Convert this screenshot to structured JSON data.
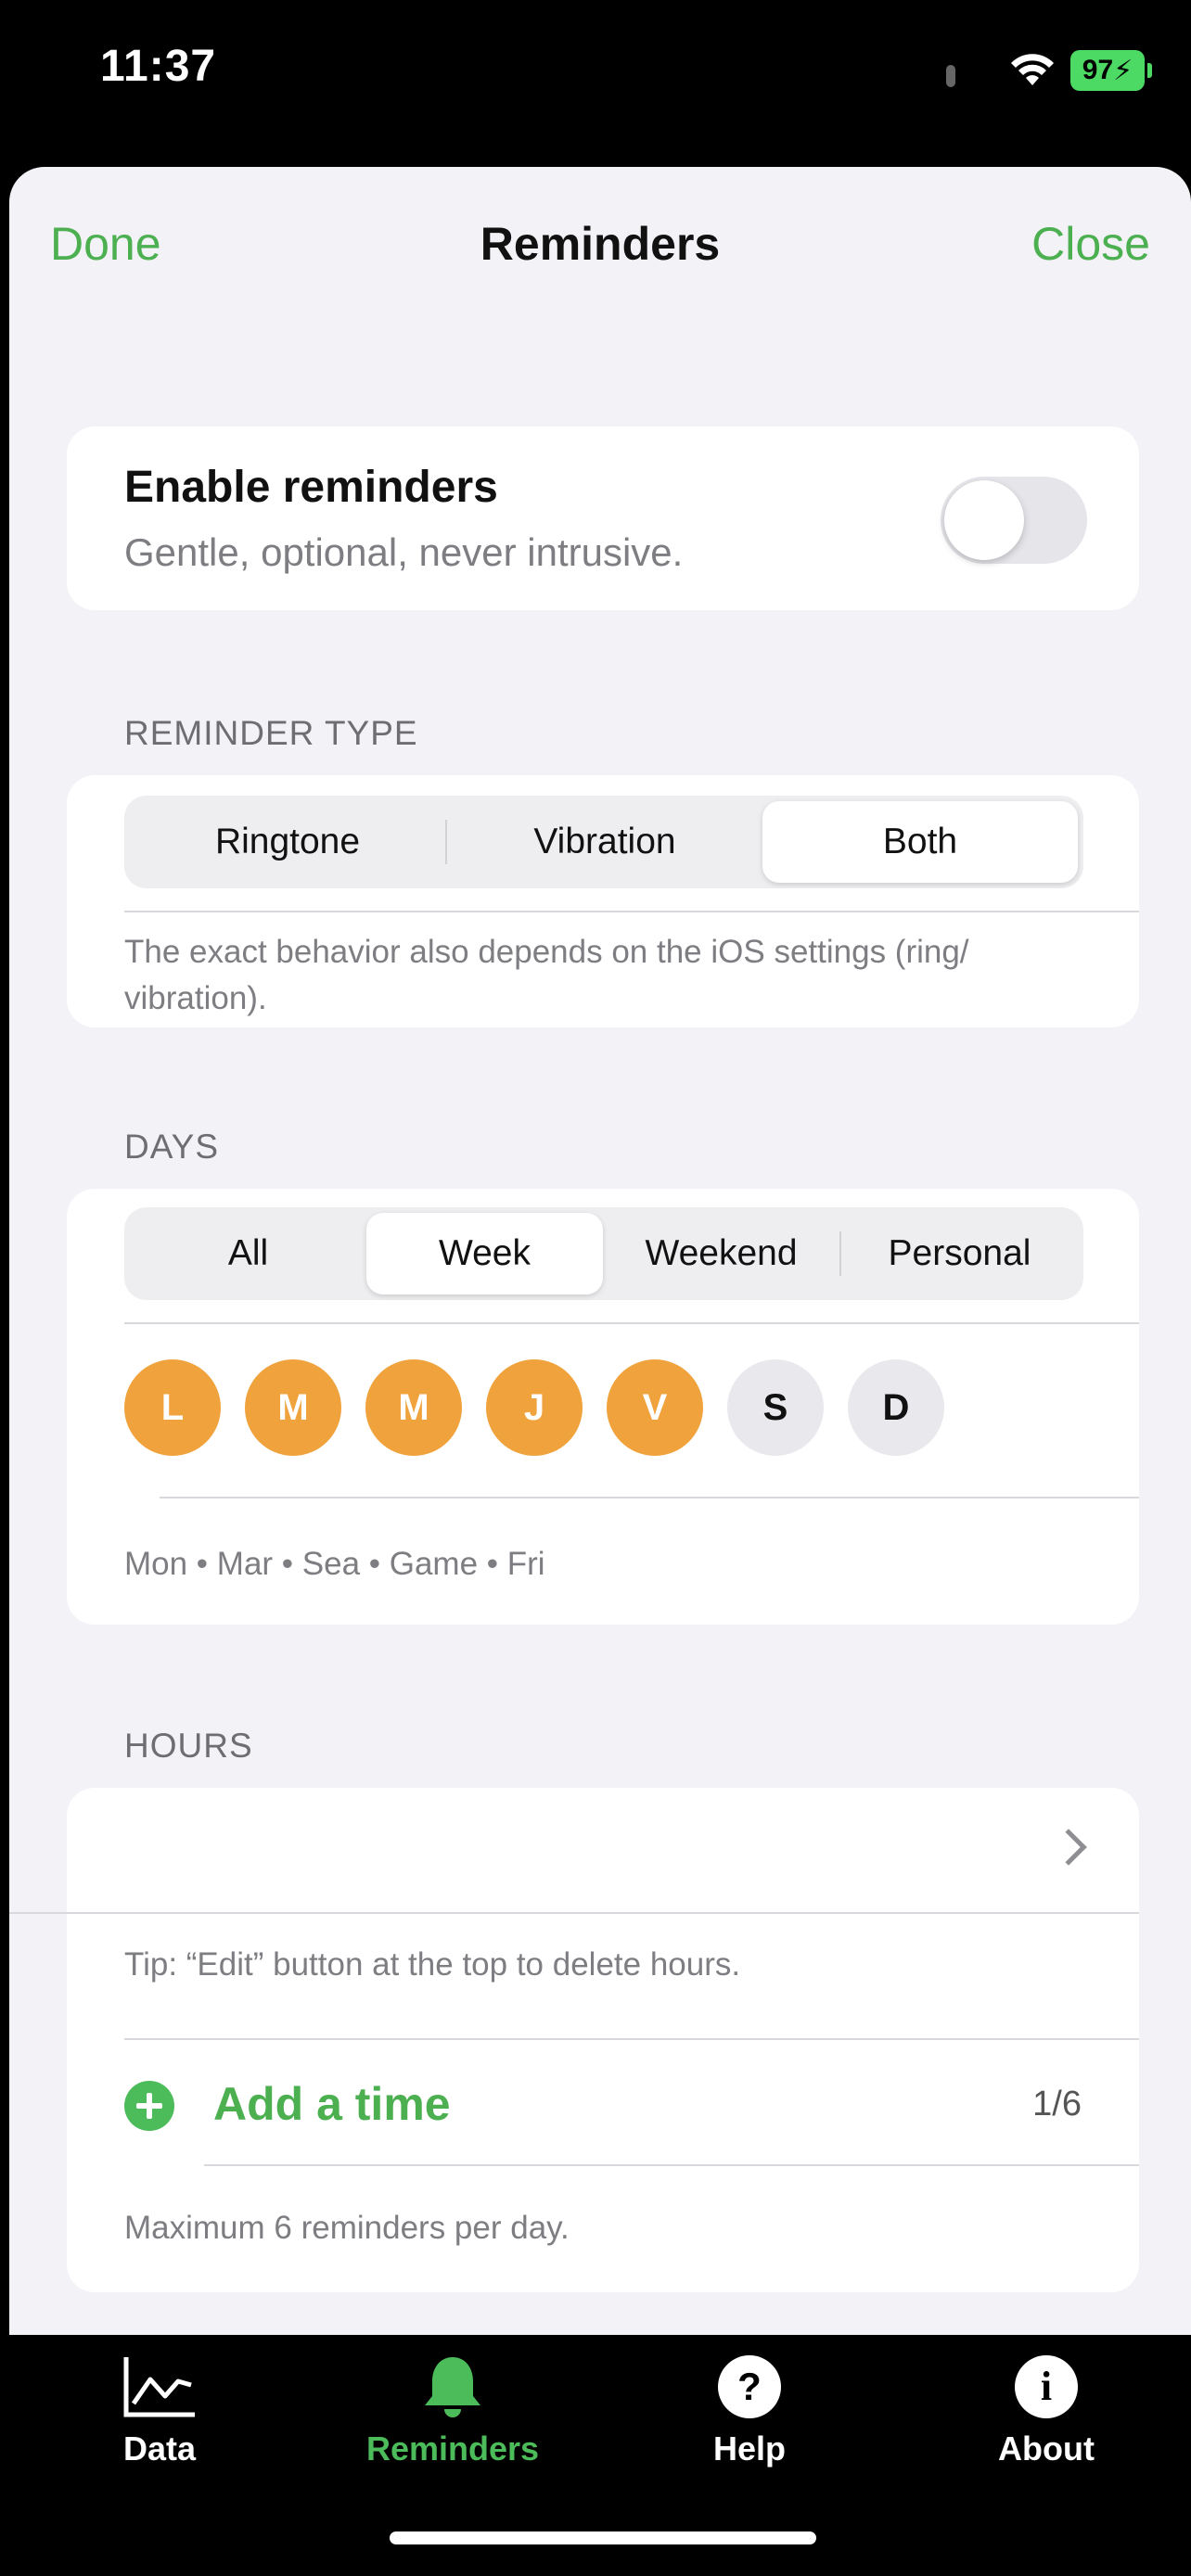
{
  "status_bar": {
    "time": "11:37",
    "battery": "97"
  },
  "nav": {
    "done": "Done",
    "title": "Reminders",
    "close": "Close"
  },
  "enable": {
    "title": "Enable reminders",
    "subtitle": "Gentle, optional, never intrusive.",
    "on": false
  },
  "reminder_type": {
    "label": "REMINDER TYPE",
    "options": [
      "Ringtone",
      "Vibration",
      "Both"
    ],
    "selected": "Both",
    "note": "The exact behavior also depends on the iOS settings (ring/ vibration)."
  },
  "days": {
    "label": "DAYS",
    "options": [
      "All",
      "Week",
      "Weekend",
      "Personal"
    ],
    "selected": "Week",
    "letters": [
      "L",
      "M",
      "M",
      "J",
      "V",
      "S",
      "D"
    ],
    "active": [
      true,
      true,
      true,
      true,
      true,
      false,
      false
    ],
    "summary": "Mon • Mar • Sea • Game • Fri"
  },
  "hours": {
    "label": "HOURS",
    "tip": "Tip: “Edit” button at the top to delete hours.",
    "add_label": "Add a time",
    "count": "1/6",
    "max_note": "Maximum 6 reminders per day."
  },
  "tabs": [
    {
      "label": "Data",
      "icon": "chart-icon"
    },
    {
      "label": "Reminders",
      "icon": "bell-icon",
      "active": true
    },
    {
      "label": "Help",
      "icon": "question-icon"
    },
    {
      "label": "About",
      "icon": "info-icon"
    }
  ],
  "colors": {
    "accent": "#4caf50",
    "day_active": "#f0a23c",
    "background": "#f2f2f7"
  }
}
